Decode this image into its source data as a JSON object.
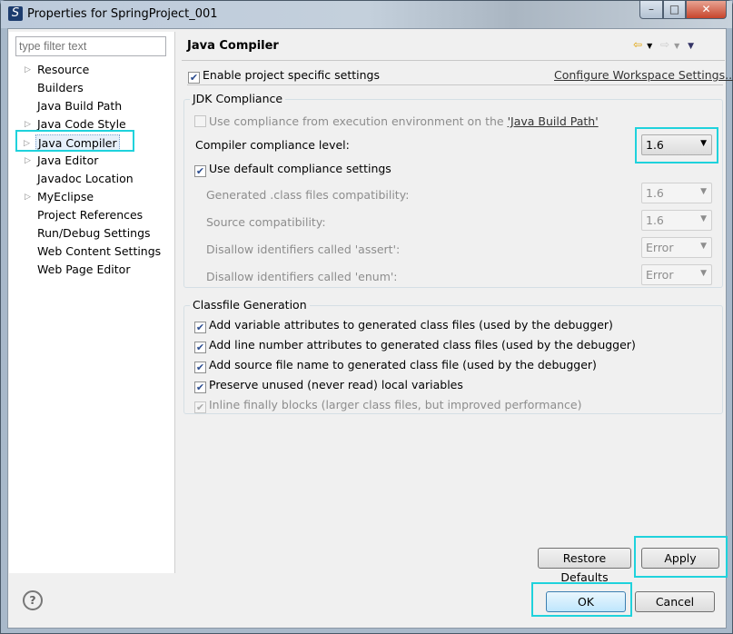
{
  "window": {
    "title": "Properties for SpringProject_001",
    "app_icon": "eclipse-s-icon",
    "controls": [
      "minimize",
      "maximize",
      "close"
    ]
  },
  "sidebar": {
    "filter_placeholder": "type filter text",
    "items": [
      {
        "label": "Resource",
        "expandable": true
      },
      {
        "label": "Builders",
        "expandable": false
      },
      {
        "label": "Java Build Path",
        "expandable": false
      },
      {
        "label": "Java Code Style",
        "expandable": true
      },
      {
        "label": "Java Compiler",
        "expandable": true,
        "selected": true
      },
      {
        "label": "Java Editor",
        "expandable": true
      },
      {
        "label": "Javadoc Location",
        "expandable": false
      },
      {
        "label": "MyEclipse",
        "expandable": true
      },
      {
        "label": "Project References",
        "expandable": false
      },
      {
        "label": "Run/Debug Settings",
        "expandable": false
      },
      {
        "label": "Web Content Settings",
        "expandable": false
      },
      {
        "label": "Web Page Editor",
        "expandable": false
      }
    ]
  },
  "page": {
    "title": "Java Compiler",
    "enable_project_settings": {
      "label": "Enable project specific settings",
      "checked": true
    },
    "configure_link": "Configure Workspace Settings...",
    "jdk": {
      "group_label": "JDK Compliance",
      "use_ee": {
        "label": "Use compliance from execution environment on the ",
        "link": "'Java Build Path'",
        "checked": false
      },
      "level_label": "Compiler compliance level:",
      "level_value": "1.6",
      "use_default": {
        "label": "Use default compliance settings",
        "checked": true
      },
      "settings": [
        {
          "label": "Generated .class files compatibility:",
          "value": "1.6"
        },
        {
          "label": "Source compatibility:",
          "value": "1.6"
        },
        {
          "label": "Disallow identifiers called 'assert':",
          "value": "Error"
        },
        {
          "label": "Disallow identifiers called 'enum':",
          "value": "Error"
        }
      ]
    },
    "classfile": {
      "group_label": "Classfile Generation",
      "options": [
        {
          "label": "Add variable attributes to generated class files (used by the debugger)",
          "checked": true,
          "enabled": true
        },
        {
          "label": "Add line number attributes to generated class files (used by the debugger)",
          "checked": true,
          "enabled": true
        },
        {
          "label": "Add source file name to generated class file (used by the debugger)",
          "checked": true,
          "enabled": true
        },
        {
          "label": "Preserve unused (never read) local variables",
          "checked": true,
          "enabled": true
        },
        {
          "label": "Inline finally blocks (larger class files, but improved performance)",
          "checked": true,
          "enabled": false
        }
      ]
    },
    "restore_defaults": "Restore Defaults",
    "apply": "Apply"
  },
  "footer": {
    "ok": "OK",
    "cancel": "Cancel",
    "help_icon": "help-icon"
  },
  "highlight_color": "#1fd2dc"
}
